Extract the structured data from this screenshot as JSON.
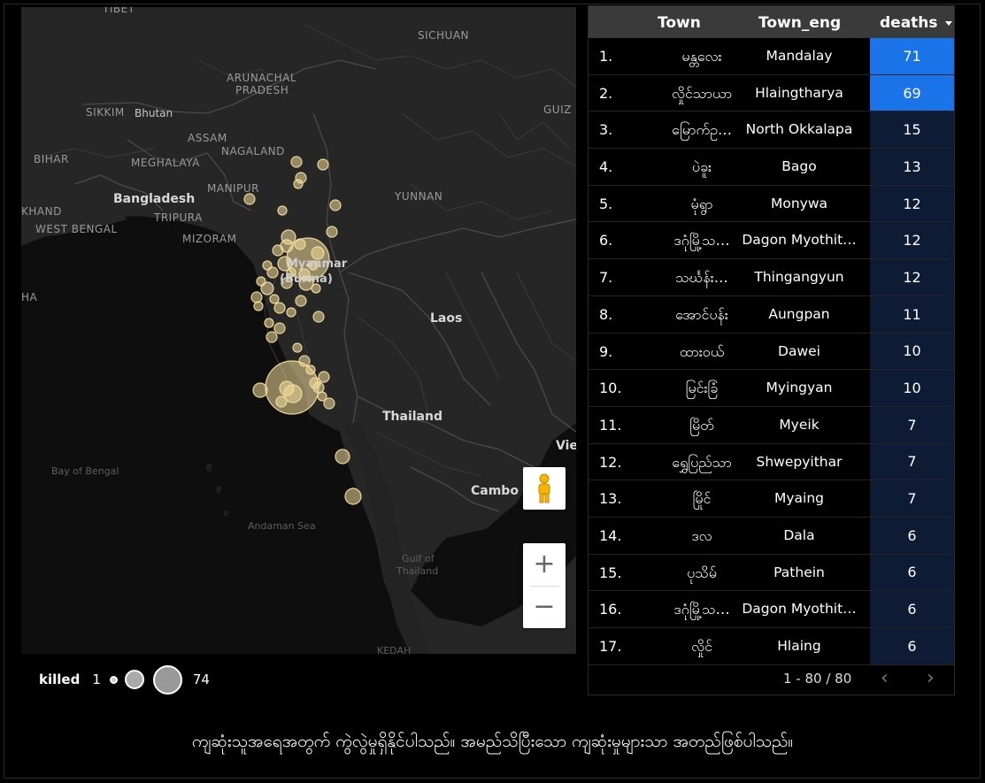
{
  "map": {
    "labels": {
      "tibet": "TIBET",
      "sichuan": "SICHUAN",
      "arunachal": "ARUNACHAL",
      "pradesh": "PRADESH",
      "sikkim": "SIKKIM",
      "bhutan": "Bhutan",
      "guizhou": "GUIZ",
      "assam": "ASSAM",
      "nagaland": "NAGALAND",
      "bihar": "BIHAR",
      "meghalaya": "MEGHALAYA",
      "manipur": "MANIPUR",
      "bangladesh": "Bangladesh",
      "tripura": "TRIPURA",
      "yunnan": "YUNNAN",
      "jharkhand": "KHAND",
      "westbengal": "WEST BENGAL",
      "mizoram": "MIZORAM",
      "myanmar": "Myanmar",
      "burma": "(Burma)",
      "laos": "Laos",
      "thailand": "Thailand",
      "vietnam": "Vie",
      "bayofbengal": "Bay of Bengal",
      "cambodia": "Cambo",
      "andamansea": "Andaman Sea",
      "gulf1": "Gulf of",
      "gulf2": "Thailand",
      "kedah": "KEDAH",
      "edge_ha": "HA"
    },
    "marker_color": "#f3dc9b",
    "zoom_in": "+",
    "zoom_out": "−"
  },
  "legend": {
    "title": "killed",
    "min": "1",
    "max": "74"
  },
  "table": {
    "columns": {
      "town": "Town",
      "town_eng": "Town_eng",
      "deaths": "deaths",
      "sort_icon": "caret-down-icon"
    },
    "max_deaths": 74,
    "highlight_color": "#1a73e8",
    "base_color": "#0d1b35",
    "rows": [
      {
        "idx": "1.",
        "town": "မန္တလေး",
        "town_eng": "Mandalay",
        "deaths": 71
      },
      {
        "idx": "2.",
        "town": "လှိုင်သာယာ",
        "town_eng": "Hlaingtharya",
        "deaths": 69
      },
      {
        "idx": "3.",
        "town": "မြောက်ဥ…",
        "town_eng": "North Okkalapa",
        "deaths": 15
      },
      {
        "idx": "4.",
        "town": "ပဲခူး",
        "town_eng": "Bago",
        "deaths": 13
      },
      {
        "idx": "5.",
        "town": "မုံရွာ",
        "town_eng": "Monywa",
        "deaths": 12
      },
      {
        "idx": "6.",
        "town": "ဒဂုံမြို့သ…",
        "town_eng": "Dagon Myothit…",
        "deaths": 12
      },
      {
        "idx": "7.",
        "town": "သင်္ဃန်း…",
        "town_eng": "Thingangyun",
        "deaths": 12
      },
      {
        "idx": "8.",
        "town": "အောင်ပန်း",
        "town_eng": "Aungpan",
        "deaths": 11
      },
      {
        "idx": "9.",
        "town": "ထားဝယ်",
        "town_eng": "Dawei",
        "deaths": 10
      },
      {
        "idx": "10.",
        "town": "မြင်းခြံ",
        "town_eng": "Myingyan",
        "deaths": 10
      },
      {
        "idx": "11.",
        "town": "မြိတ်",
        "town_eng": "Myeik",
        "deaths": 7
      },
      {
        "idx": "12.",
        "town": "ရွှေပြည်သာ",
        "town_eng": "Shwepyithar",
        "deaths": 7
      },
      {
        "idx": "13.",
        "town": "မြိုင်",
        "town_eng": "Myaing",
        "deaths": 7
      },
      {
        "idx": "14.",
        "town": "ဒလ",
        "town_eng": "Dala",
        "deaths": 6
      },
      {
        "idx": "15.",
        "town": "ပုသိမ်",
        "town_eng": "Pathein",
        "deaths": 6
      },
      {
        "idx": "16.",
        "town": "ဒဂုံမြို့သ…",
        "town_eng": "Dagon Myothit…",
        "deaths": 6
      },
      {
        "idx": "17.",
        "town": "လှိုင်",
        "town_eng": "Hlaing",
        "deaths": 6
      }
    ]
  },
  "pager": {
    "range": "1 - 80 / 80",
    "prev": "‹",
    "next": "›"
  },
  "caption": "ကျဆုံးသူအရေအတွက် ကွဲလွဲမှုရှိနိုင်ပါသည်။ အမည်သိပြီးသော ကျဆုံးမှုများသာ အတည်ဖြစ်ပါသည်။"
}
